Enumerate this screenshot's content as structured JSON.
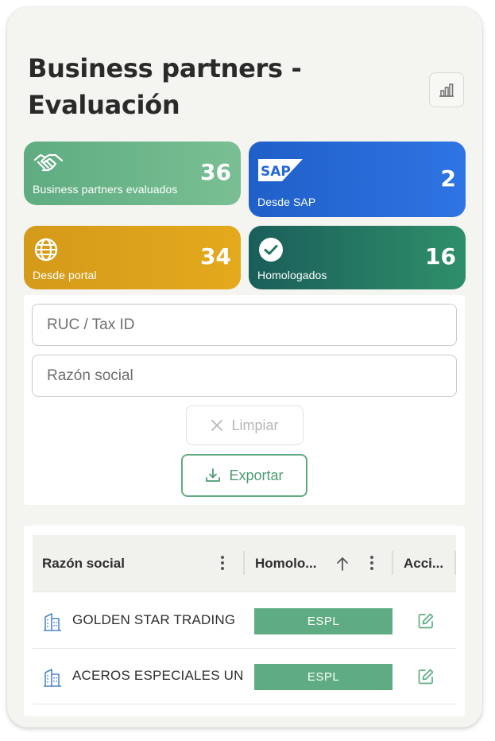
{
  "page": {
    "title": "Business partners - Evaluación"
  },
  "toolbar": {
    "chart_icon": "bar-chart-icon"
  },
  "stats": {
    "evaluated": {
      "value": "36",
      "label": "Business partners evaluados",
      "icon": "handshake-icon",
      "color": "#6db78b"
    },
    "sap": {
      "value": "2",
      "label": "Desde SAP",
      "icon_text": "SAP",
      "color": "#2668d6"
    },
    "portal": {
      "value": "34",
      "label": "Desde portal",
      "icon": "globe-icon",
      "color": "#dca11b"
    },
    "homologated": {
      "value": "16",
      "label": "Homologados",
      "icon": "check-circle-icon",
      "color": "#237665"
    }
  },
  "filters": {
    "ruc_placeholder": "RUC / Tax ID",
    "razon_placeholder": "Razón social",
    "clear_label": "Limpiar",
    "export_label": "Exportar"
  },
  "table": {
    "columns": {
      "razon": "Razón social",
      "homologado": "Homolo...",
      "acciones": "Acci..."
    },
    "rows": [
      {
        "name": "GOLDEN STAR TRADING",
        "status": "ESPL"
      },
      {
        "name": "ACEROS ESPECIALES UN",
        "status": "ESPL"
      }
    ]
  },
  "colors": {
    "accent_green": "#5fac82",
    "background": "#f4f4f1"
  }
}
